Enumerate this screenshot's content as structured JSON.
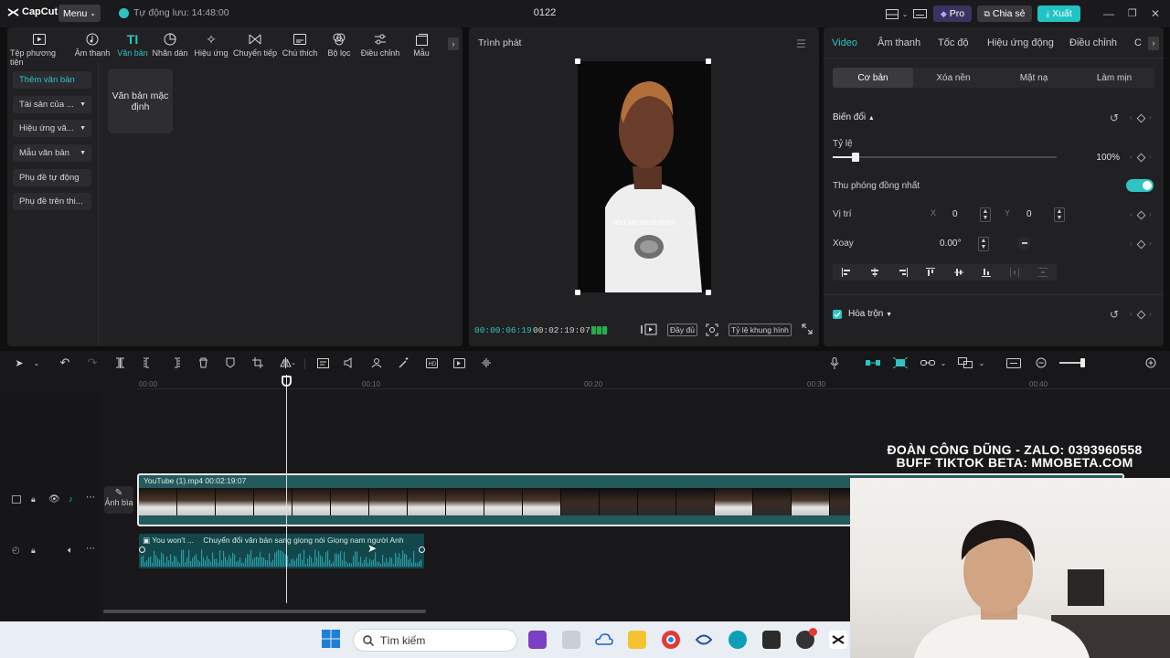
{
  "app": {
    "logo": "CapCut",
    "menu_label": "Menu",
    "autosave": "Tự động lưu: 14:48:00",
    "project_title": "0122",
    "pro_label": "Pro",
    "share_label": "Chia sẻ",
    "export_label": "Xuất"
  },
  "toolbar_tabs": [
    {
      "label": "Tệp phương tiện",
      "icon": "media-icon"
    },
    {
      "label": "Âm thanh",
      "icon": "audio-icon"
    },
    {
      "label": "Văn bản",
      "icon": "text-icon",
      "active": true
    },
    {
      "label": "Nhãn dán",
      "icon": "sticker-icon"
    },
    {
      "label": "Hiệu ứng",
      "icon": "effects-icon"
    },
    {
      "label": "Chuyển tiếp",
      "icon": "transition-icon"
    },
    {
      "label": "Chú thích",
      "icon": "captions-icon"
    },
    {
      "label": "Bộ lọc",
      "icon": "filter-icon"
    },
    {
      "label": "Điều chỉnh",
      "icon": "adjust-icon"
    },
    {
      "label": "Mẫu",
      "icon": "template-icon"
    }
  ],
  "sidebar": {
    "items": [
      {
        "label": "Thêm văn bản",
        "active": true,
        "dropdown": false
      },
      {
        "label": "Tài sản của ...",
        "dropdown": true
      },
      {
        "label": "Hiệu ứng vă...",
        "dropdown": true
      },
      {
        "label": "Mẫu văn bản",
        "dropdown": true
      },
      {
        "label": "Phụ đề tự động",
        "dropdown": false
      },
      {
        "label": "Phụ đề trên thi...",
        "dropdown": false
      }
    ]
  },
  "text_card": {
    "label": "Văn bản mặc định"
  },
  "player": {
    "title": "Trình phát",
    "subtitle": "and we stand there",
    "current_time": "00:00:06:19",
    "total_time": "00:02:19:07",
    "full_label": "Đầy đủ",
    "ratio_label": "Tỷ lệ khung hình"
  },
  "props": {
    "tabs": [
      "Video",
      "Âm thanh",
      "Tốc độ",
      "Hiệu ứng động",
      "Điều chỉnh",
      "C"
    ],
    "subtabs": [
      "Cơ bản",
      "Xóa nền",
      "Mặt nạ",
      "Làm mịn"
    ],
    "transform_label": "Biến đổi",
    "scale_label": "Tỷ lệ",
    "scale_value": "100%",
    "scale_fraction": 0.1,
    "uniform_label": "Thu phóng đồng nhất",
    "uniform_on": true,
    "position_label": "Vị trí",
    "x_label": "X",
    "x_value": "0",
    "y_label": "Y",
    "y_value": "0",
    "rotate_label": "Xoay",
    "rotate_value": "0.00°",
    "blend_label": "Hòa trộn"
  },
  "timeline": {
    "ruler": [
      "00:00",
      "00:10",
      "00:20",
      "00:30",
      "00:40"
    ],
    "cover_label": "Ảnh bìa",
    "video_clip_title": "YouTube (1).mp4   00:02:19:07",
    "audio_clip_title": "You won't ...",
    "audio_clip_desc": "Chuyển đổi văn bản sang giọng nói Giọng nam người Anh"
  },
  "watermark": {
    "line1": "ĐOÀN CÔNG DŨNG - ZALO: 0393960558",
    "line2": "BUFF TIKTOK BETA: MMOBETA.COM"
  },
  "taskbar": {
    "search_placeholder": "Tìm kiếm"
  },
  "colors": {
    "accent": "#2ec4c4",
    "panel": "#212124",
    "background": "#0f0f10"
  }
}
